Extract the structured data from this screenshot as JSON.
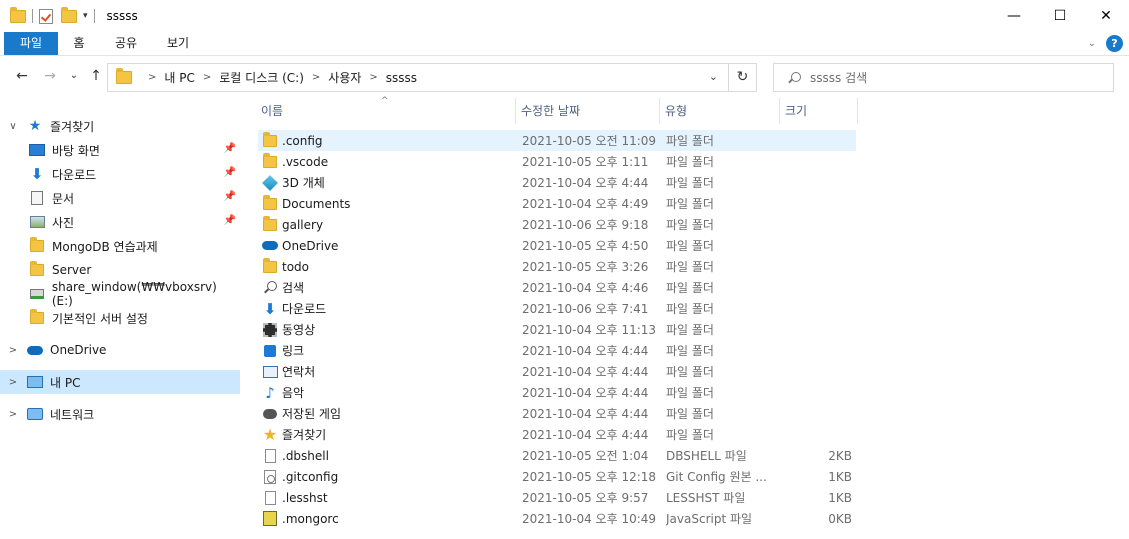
{
  "window": {
    "title": "sssss",
    "qat_dropdown": "▾",
    "controls": {
      "minimize": "—",
      "maximize": "☐",
      "close": "✕"
    }
  },
  "ribbon": {
    "tabs": [
      "파일",
      "홈",
      "공유",
      "보기"
    ],
    "expand": "⌄",
    "help": "?"
  },
  "nav": {
    "back": "←",
    "forward": "→",
    "recent": "⌄",
    "up": "↑",
    "breadcrumbs": [
      "내 PC",
      "로컬 디스크 (C:)",
      "사용자",
      "sssss"
    ],
    "crumb_sep": ">",
    "dropdown": "⌄",
    "refresh": "↻",
    "search_placeholder": "sssss 검색"
  },
  "navpane": {
    "quick_access": "즐겨찾기",
    "pinned": [
      {
        "label": "바탕 화면",
        "icon": "desktop-icon"
      },
      {
        "label": "다운로드",
        "icon": "download-icon"
      },
      {
        "label": "문서",
        "icon": "documents-icon"
      },
      {
        "label": "사진",
        "icon": "pictures-icon"
      }
    ],
    "folders": [
      {
        "label": "MongoDB 연습과제",
        "icon": "folder-icon"
      },
      {
        "label": "Server",
        "icon": "folder-icon"
      },
      {
        "label": "share_window(₩₩vboxsrv) (E:)",
        "icon": "network-drive-icon"
      },
      {
        "label": "기본적인 서버 설정",
        "icon": "folder-icon"
      }
    ],
    "onedrive": "OneDrive",
    "this_pc": "내 PC",
    "network": "네트워크",
    "expand_open": "∨",
    "expand_closed": ">",
    "pin_glyph": "📌"
  },
  "columns": {
    "name": "이름",
    "date": "수정한 날짜",
    "type": "유형",
    "size": "크기",
    "sort_arrow": "^"
  },
  "files": [
    {
      "name": ".config",
      "date": "2021-10-05 오전 11:09",
      "type": "파일 폴더",
      "size": "",
      "icon": "folder-icon",
      "selected": true
    },
    {
      "name": ".vscode",
      "date": "2021-10-05 오후 1:11",
      "type": "파일 폴더",
      "size": "",
      "icon": "folder-icon"
    },
    {
      "name": "3D 개체",
      "date": "2021-10-04 오후 4:44",
      "type": "파일 폴더",
      "size": "",
      "icon": "3d-objects-icon"
    },
    {
      "name": "Documents",
      "date": "2021-10-04 오후 4:49",
      "type": "파일 폴더",
      "size": "",
      "icon": "folder-icon"
    },
    {
      "name": "gallery",
      "date": "2021-10-06 오후 9:18",
      "type": "파일 폴더",
      "size": "",
      "icon": "folder-icon"
    },
    {
      "name": "OneDrive",
      "date": "2021-10-05 오후 4:50",
      "type": "파일 폴더",
      "size": "",
      "icon": "onedrive-cloud-icon"
    },
    {
      "name": "todo",
      "date": "2021-10-05 오후 3:26",
      "type": "파일 폴더",
      "size": "",
      "icon": "folder-icon"
    },
    {
      "name": "검색",
      "date": "2021-10-04 오후 4:46",
      "type": "파일 폴더",
      "size": "",
      "icon": "searches-icon"
    },
    {
      "name": "다운로드",
      "date": "2021-10-06 오후 7:41",
      "type": "파일 폴더",
      "size": "",
      "icon": "download-icon"
    },
    {
      "name": "동영상",
      "date": "2021-10-04 오후 11:13",
      "type": "파일 폴더",
      "size": "",
      "icon": "videos-icon"
    },
    {
      "name": "링크",
      "date": "2021-10-04 오후 4:44",
      "type": "파일 폴더",
      "size": "",
      "icon": "links-icon"
    },
    {
      "name": "연락처",
      "date": "2021-10-04 오후 4:44",
      "type": "파일 폴더",
      "size": "",
      "icon": "contacts-icon"
    },
    {
      "name": "음악",
      "date": "2021-10-04 오후 4:44",
      "type": "파일 폴더",
      "size": "",
      "icon": "music-icon"
    },
    {
      "name": "저장된 게임",
      "date": "2021-10-04 오후 4:44",
      "type": "파일 폴더",
      "size": "",
      "icon": "saved-games-icon"
    },
    {
      "name": "즐겨찾기",
      "date": "2021-10-04 오후 4:44",
      "type": "파일 폴더",
      "size": "",
      "icon": "favorites-star-icon"
    },
    {
      "name": ".dbshell",
      "date": "2021-10-05 오전 1:04",
      "type": "DBSHELL 파일",
      "size": "2KB",
      "icon": "file-icon"
    },
    {
      "name": ".gitconfig",
      "date": "2021-10-05 오후 12:18",
      "type": "Git Config 원본 ...",
      "size": "1KB",
      "icon": "config-file-icon"
    },
    {
      "name": ".lesshst",
      "date": "2021-10-05 오후 9:57",
      "type": "LESSHST 파일",
      "size": "1KB",
      "icon": "file-icon"
    },
    {
      "name": ".mongorc",
      "date": "2021-10-04 오후 10:49",
      "type": "JavaScript 파일",
      "size": "0KB",
      "icon": "javascript-file-icon"
    }
  ],
  "colors": {
    "accent": "#1979ca",
    "selected_nav": "#cce8ff",
    "selected_row": "#e5f3ff",
    "header_text": "#4d6082",
    "muted_text": "#6d6d6d"
  }
}
